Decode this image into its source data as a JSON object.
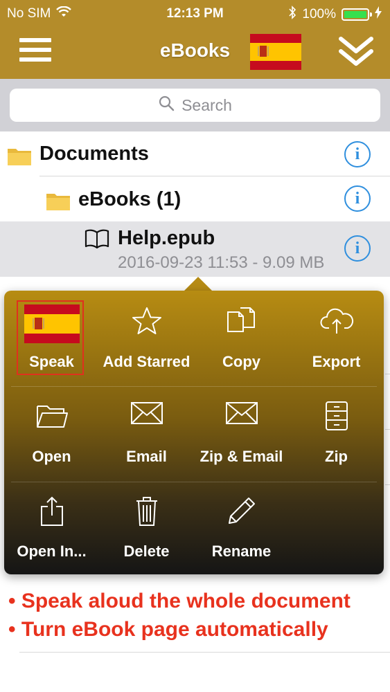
{
  "status_bar": {
    "carrier": "No SIM",
    "time": "12:13 PM",
    "battery": "100%"
  },
  "nav": {
    "title": "eBooks"
  },
  "search": {
    "placeholder": "Search"
  },
  "list": {
    "root": {
      "label": "Documents"
    },
    "folder": {
      "label": "eBooks (1)"
    },
    "file": {
      "name": "Help.epub",
      "meta": "2016-09-23 11:53 - 9.09 MB"
    }
  },
  "actions": [
    {
      "label": "Speak",
      "icon": "spain-flag-icon"
    },
    {
      "label": "Add Starred",
      "icon": "star-icon"
    },
    {
      "label": "Copy",
      "icon": "copy-icon"
    },
    {
      "label": "Export",
      "icon": "cloud-upload-icon"
    },
    {
      "label": "Open",
      "icon": "folder-open-icon"
    },
    {
      "label": "Email",
      "icon": "envelope-icon"
    },
    {
      "label": "Zip & Email",
      "icon": "envelope-icon"
    },
    {
      "label": "Zip",
      "icon": "archive-icon"
    },
    {
      "label": "Open In...",
      "icon": "share-icon"
    },
    {
      "label": "Delete",
      "icon": "trash-icon"
    },
    {
      "label": "Rename",
      "icon": "pencil-icon"
    }
  ],
  "promo": [
    "Speak aloud the whole document",
    "Turn eBook page automatically"
  ],
  "colors": {
    "accent": "#b48c2a",
    "info_blue": "#2f8fde",
    "promo_red": "#e8321e",
    "highlight": "#e0301e"
  }
}
